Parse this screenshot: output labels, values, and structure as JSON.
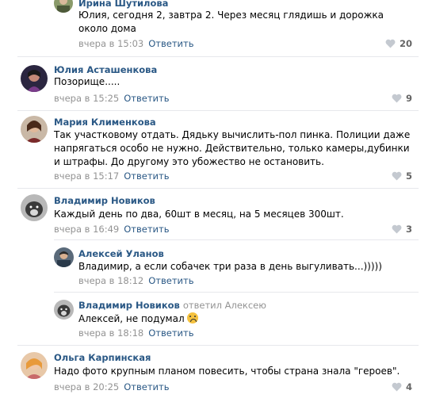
{
  "comments": [
    {
      "author": "Ирина Шутилова",
      "text": "Юлия, сегодня 2, завтра 2. Через месяц глядишь и дорожка около дома",
      "time": "вчера в 15:03",
      "reply_label": "Ответить",
      "likes": "20"
    },
    {
      "author": "Юлия Асташенкова",
      "text": "Позорище.....",
      "time": "вчера в 15:25",
      "reply_label": "Ответить",
      "likes": "9"
    },
    {
      "author": "Мария Клименкова",
      "text": "Так участковому отдать. Дядьку вычислить-пол пинка. Полиции даже напрягаться особо не нужно. Действительно, только камеры,дубинки и штрафы. До другому это убожество не остановить.",
      "time": "вчера в 15:17",
      "reply_label": "Ответить",
      "likes": "5"
    },
    {
      "author": "Владимир Новиков",
      "text": "Каждый день по два, 60шт в месяц, на 5 месяцев 300шт.",
      "time": "вчера в 16:49",
      "reply_label": "Ответить",
      "likes": "3"
    },
    {
      "author": "Алексей Уланов",
      "text": "Владимир, а если собачек три раза в день выгуливать...)))))",
      "time": "вчера в 18:12",
      "reply_label": "Ответить"
    },
    {
      "author": "Владимир Новиков",
      "replied_to": "ответил Алексею",
      "text": "Алексей, не подумал",
      "time": "вчера в 18:18",
      "reply_label": "Ответить"
    },
    {
      "author": "Ольга Карпинская",
      "text": "Надо фото крупным планом повесить, чтобы страна знала \"героев\".",
      "time": "вчера в 20:25",
      "reply_label": "Ответить",
      "likes": "4"
    }
  ],
  "colors": {
    "author_link": "#2a5885",
    "meta_gray": "#939393",
    "separator": "#e7e8ec",
    "like_heart": "#c4c9d0"
  },
  "icons": {
    "like": "heart-icon",
    "emoji": "tired-face-emoji-icon"
  }
}
